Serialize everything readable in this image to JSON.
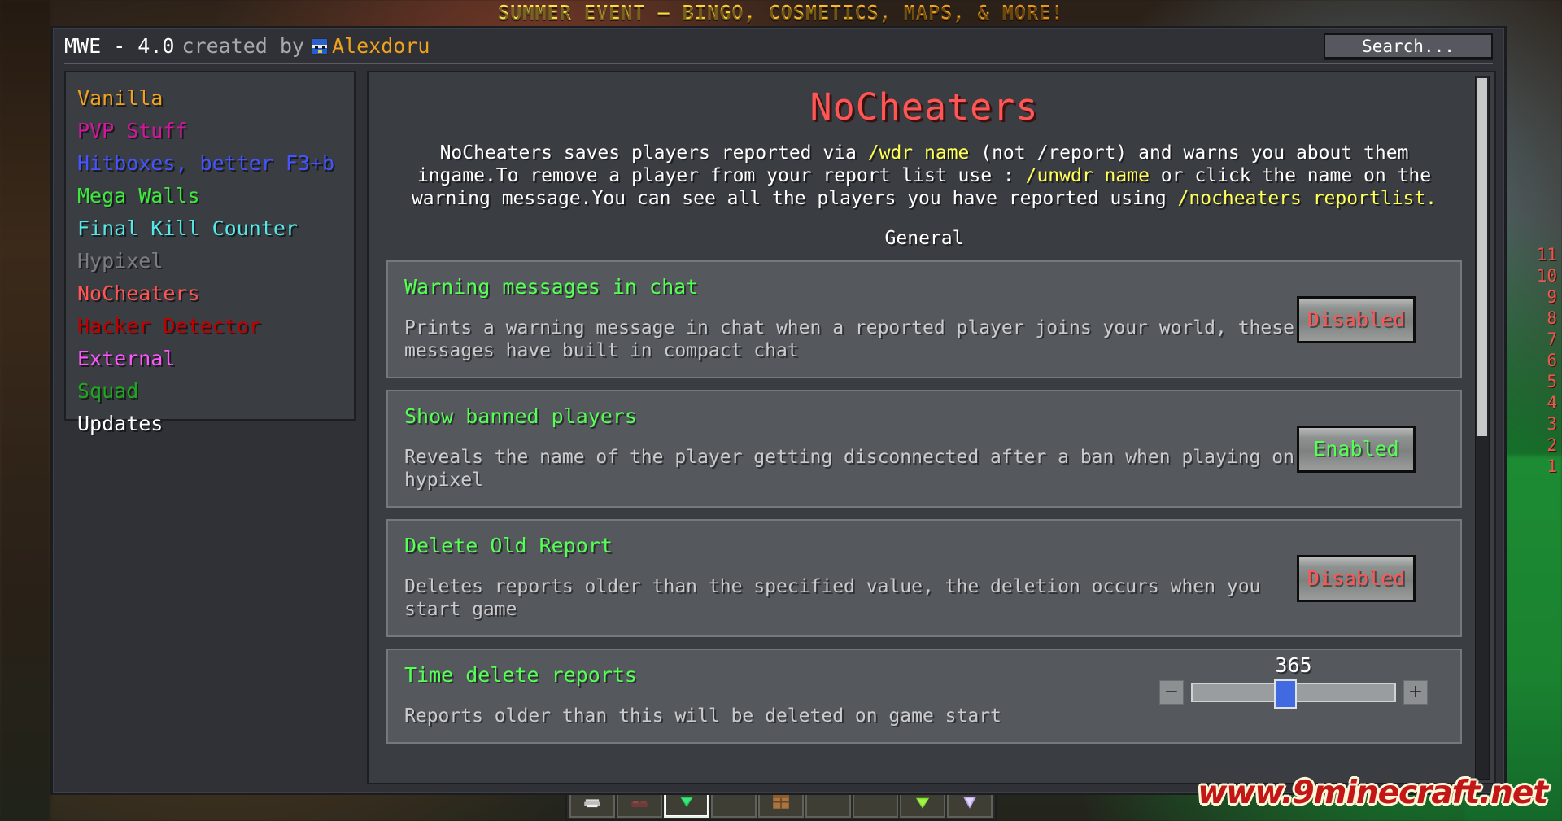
{
  "banner": {
    "text": "SUMMER EVENT — BINGO, COSMETICS, MAPS, & MORE!"
  },
  "window": {
    "title_main": "MWE - 4.0",
    "title_by": "created by",
    "author": "Alexdoru",
    "search_label": "Search..."
  },
  "sidebar": {
    "items": [
      {
        "label": "Vanilla",
        "color": "#f0a21c"
      },
      {
        "label": "PVP Stuff",
        "color": "#d4169c"
      },
      {
        "label": "Hitboxes, better F3+b",
        "color": "#4455ff"
      },
      {
        "label": "Mega Walls",
        "color": "#3ee83e"
      },
      {
        "label": "Final Kill Counter",
        "color": "#55e8e8"
      },
      {
        "label": "Hypixel",
        "color": "#7a7d82"
      },
      {
        "label": "NoCheaters",
        "color": "#ff5555"
      },
      {
        "label": "Hacker Detector",
        "color": "#c00000"
      },
      {
        "label": "External",
        "color": "#ff55ff"
      },
      {
        "label": "Squad",
        "color": "#1ea81e"
      },
      {
        "label": "Updates",
        "color": "#ffffff"
      }
    ]
  },
  "panel": {
    "title": "NoCheaters",
    "title_color": "#ff5555",
    "description_parts": [
      {
        "text": "NoCheaters saves players reported via ",
        "highlight": false
      },
      {
        "text": "/wdr name",
        "highlight": true
      },
      {
        "text": " (not /report) and warns you about them ingame.To remove a player from your report list use : ",
        "highlight": false
      },
      {
        "text": "/unwdr name",
        "highlight": true
      },
      {
        "text": " or click the name on the warning message.You can see all the players you have reported using ",
        "highlight": false
      },
      {
        "text": "/nocheaters reportlist.",
        "highlight": true
      }
    ],
    "section_label": "General",
    "settings": [
      {
        "name": "Warning messages in chat",
        "description": "Prints a warning message in chat when a reported player joins your world, these messages have built in compact chat",
        "control": "toggle",
        "value": "Disabled",
        "state": "off"
      },
      {
        "name": "Show banned players",
        "description": "Reveals the name of the player getting disconnected after a ban when playing on hypixel",
        "control": "toggle",
        "value": "Enabled",
        "state": "on"
      },
      {
        "name": "Delete Old Report",
        "description": "Deletes reports older than the specified value, the deletion occurs when you start game",
        "control": "toggle",
        "value": "Disabled",
        "state": "off"
      },
      {
        "name": "Time delete reports",
        "description": "Reports older than this will be deleted on game start",
        "control": "slider",
        "value": "365",
        "slider_percent": 46,
        "decrement_label": "−",
        "increment_label": "+"
      }
    ]
  },
  "hud": {
    "numbers": [
      "11",
      "10",
      "9",
      "8",
      "7",
      "6",
      "5",
      "4",
      "3",
      "2",
      "1"
    ],
    "number_color": "#f05a50"
  },
  "hotbar": {
    "selected_index": 2,
    "slots": [
      {
        "item": "iron-helmet"
      },
      {
        "item": "netherrack"
      },
      {
        "item": "emerald"
      },
      {
        "item": "empty"
      },
      {
        "item": "crafting-table"
      },
      {
        "item": "empty"
      },
      {
        "item": "empty"
      },
      {
        "item": "slime-ball"
      },
      {
        "item": "amethyst-shard"
      }
    ]
  },
  "watermark": {
    "text": "www.9minecraft.net"
  }
}
